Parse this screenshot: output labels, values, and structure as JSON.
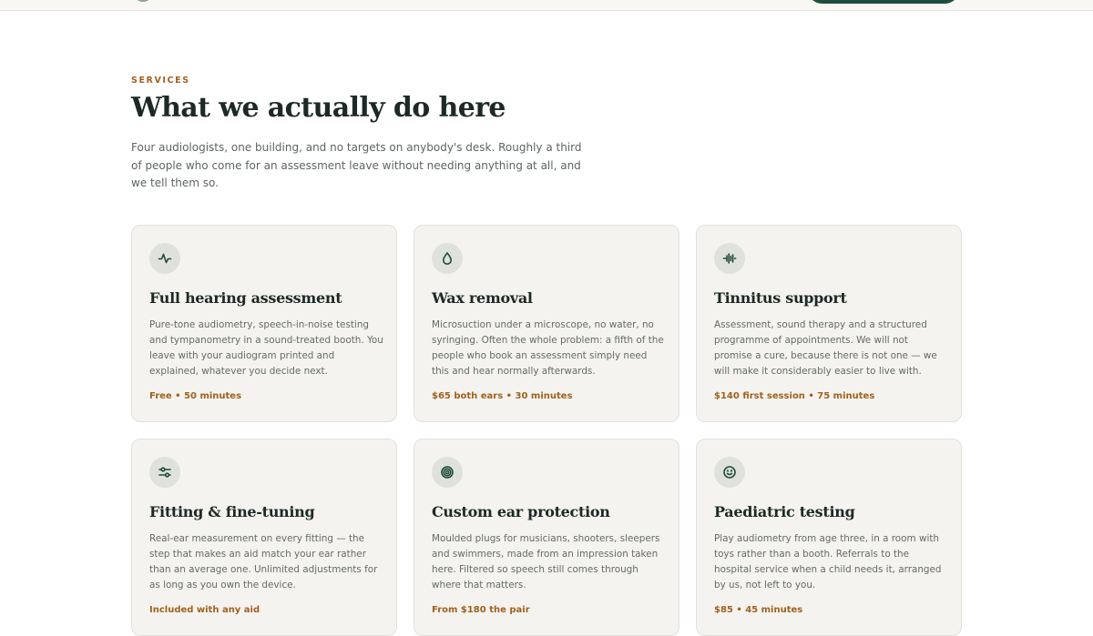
{
  "header": {
    "eyebrow": "SERVICES",
    "title": "What we actually do here",
    "intro": "Four audiologists, one building, and no targets on anybody's desk. Roughly a third of people who come for an assessment leave without needing anything at all, and we tell them so."
  },
  "colors": {
    "accent": "#a0621e",
    "brand": "#1e4d3c",
    "card_bg": "#f4f3ef",
    "icon_bg": "#dfe2dc"
  },
  "services": [
    {
      "icon": "pulse-icon",
      "title": "Full hearing assessment",
      "description": "Pure-tone audiometry, speech-in-noise testing and tympanometry in a sound-treated booth. You leave with your audiogram printed and explained, whatever you decide next.",
      "price": "Free • 50 minutes"
    },
    {
      "icon": "droplet-icon",
      "title": "Wax removal",
      "description": "Microsuction under a microscope, no water, no syringing. Often the whole problem: a fifth of the people who book an assessment simply need this and hear normally afterwards.",
      "price": "$65 both ears • 30 minutes"
    },
    {
      "icon": "waveform-icon",
      "title": "Tinnitus support",
      "description": "Assessment, sound therapy and a structured programme of appointments. We will not promise a cure, because there is not one — we will make it considerably easier to live with.",
      "price": "$140 first session • 75 minutes"
    },
    {
      "icon": "sliders-icon",
      "title": "Fitting & fine-tuning",
      "description": "Real-ear measurement on every fitting — the step that makes an aid match your ear rather than an average one. Unlimited adjustments for as long as you own the device.",
      "price": "Included with any aid"
    },
    {
      "icon": "spiral-icon",
      "title": "Custom ear protection",
      "description": "Moulded plugs for musicians, shooters, sleepers and swimmers, made from an impression taken here. Filtered so speech still comes through where that matters.",
      "price": "From $180 the pair"
    },
    {
      "icon": "smile-icon",
      "title": "Paediatric testing",
      "description": "Play audiometry from age three, in a room with toys rather than a booth. Referrals to the hospital service when a child needs it, arranged by us, not left to you.",
      "price": "$85 • 45 minutes"
    }
  ]
}
